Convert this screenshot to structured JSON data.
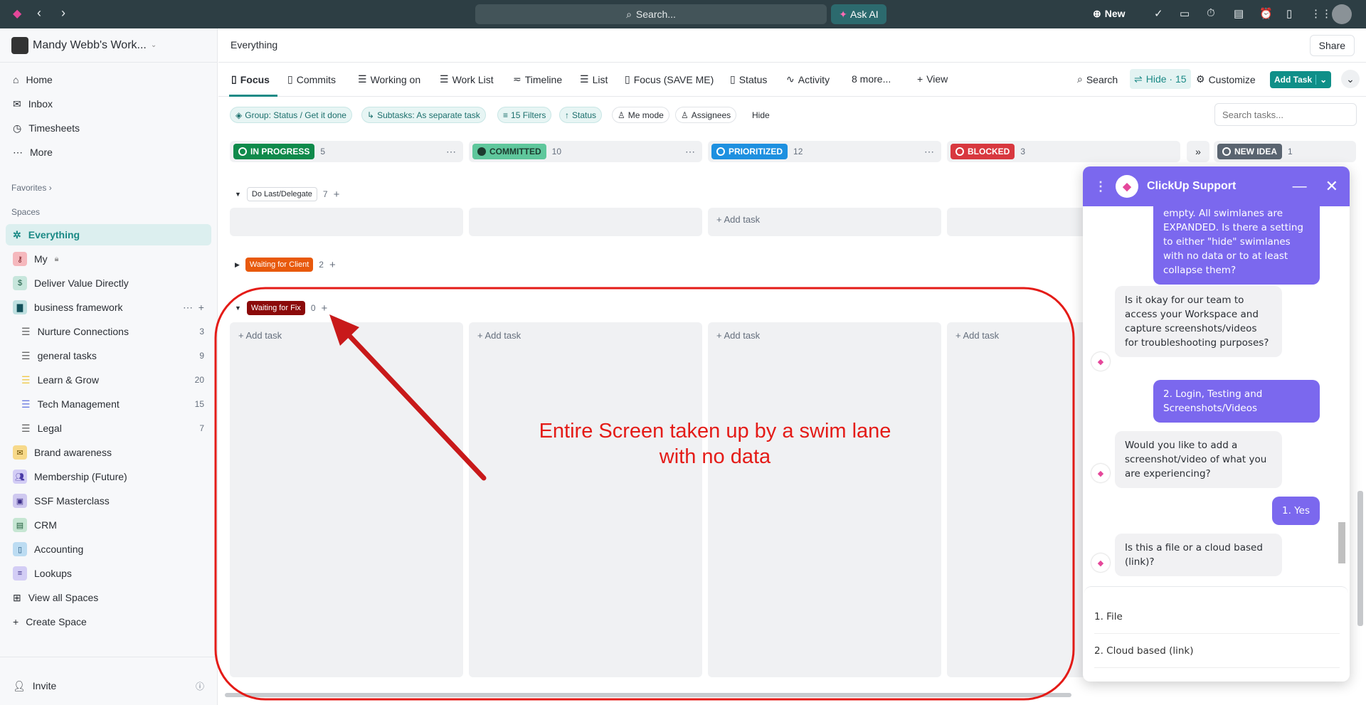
{
  "topbar": {
    "search": "Search...",
    "ask_ai": "Ask AI",
    "new": "New"
  },
  "sidebar": {
    "workspace": "Mandy Webb's Work...",
    "nav": [
      "Home",
      "Inbox",
      "Timesheets",
      "More"
    ],
    "favorites": "Favorites",
    "spaces_label": "Spaces",
    "spaces": [
      {
        "label": "Everything"
      },
      {
        "label": "My"
      },
      {
        "label": "Deliver Value Directly"
      },
      {
        "label": "business framework"
      },
      {
        "label": "Nurture Connections",
        "count": "3"
      },
      {
        "label": "general tasks",
        "count": "9"
      },
      {
        "label": "Learn & Grow",
        "count": "20"
      },
      {
        "label": "Tech Management",
        "count": "15"
      },
      {
        "label": "Legal",
        "count": "7"
      },
      {
        "label": "Brand awareness"
      },
      {
        "label": "Membership (Future)"
      },
      {
        "label": "SSF Masterclass"
      },
      {
        "label": "CRM"
      },
      {
        "label": "Accounting"
      },
      {
        "label": "Lookups"
      },
      {
        "label": "View all Spaces"
      },
      {
        "label": "Create Space"
      }
    ],
    "invite": "Invite"
  },
  "header": {
    "title": "Everything",
    "share": "Share"
  },
  "tabs": [
    "Focus",
    "Commits",
    "Working on",
    "Work List",
    "Timeline",
    "List",
    "Focus (SAVE ME)",
    "Status",
    "Activity",
    "8 more...",
    "View"
  ],
  "toolbar": {
    "search": "Search",
    "hide": "Hide · 15",
    "customize": "Customize",
    "add_task": "Add Task"
  },
  "filters": {
    "group": "Group: Status / Get it done",
    "subtasks": "Subtasks: As separate task",
    "filters": "15 Filters",
    "status": "Status",
    "me_mode": "Me mode",
    "assignees": "Assignees",
    "hide": "Hide",
    "search_placeholder": "Search tasks..."
  },
  "columns": [
    {
      "label": "IN PROGRESS",
      "count": "5",
      "color": "#0f8a4b"
    },
    {
      "label": "COMMITTED",
      "count": "10",
      "color": "#5fc79c"
    },
    {
      "label": "PRIORITIZED",
      "count": "12",
      "color": "#1e90e0"
    },
    {
      "label": "BLOCKED",
      "count": "3",
      "color": "#d8383f"
    },
    {
      "label": "NEW IDEA",
      "count": "1",
      "color": "#5a6470"
    }
  ],
  "groups": [
    {
      "label": "Do Last/Delegate",
      "count": "7"
    },
    {
      "label": "Waiting for Client",
      "count": "2",
      "color": "#e8590c"
    },
    {
      "label": "Waiting for Fix",
      "count": "0",
      "color": "#8b0a0a"
    }
  ],
  "add_task": "Add task",
  "annotation": {
    "line1": "Entire Screen taken up by a swim lane",
    "line2": "with no data"
  },
  "chat": {
    "title": "ClickUp Support",
    "messages": [
      {
        "from": "user",
        "text": "empty.  All swimlanes are EXPANDED.  Is there a setting to either \"hide\" swimlanes with no data or to at least collapse them?"
      },
      {
        "from": "bot",
        "text": "Is it okay for our team to access your Workspace and capture screenshots/videos for troubleshooting purposes?"
      },
      {
        "from": "user",
        "text": "2. Login, Testing and Screenshots/Videos"
      },
      {
        "from": "bot",
        "text": "Would you like to add a screenshot/video of what you are experiencing?"
      },
      {
        "from": "user",
        "text": "1. Yes"
      },
      {
        "from": "bot",
        "text": "Is this a file or a cloud based (link)?"
      }
    ],
    "options": [
      "1. File",
      "2. Cloud based (link)"
    ]
  }
}
